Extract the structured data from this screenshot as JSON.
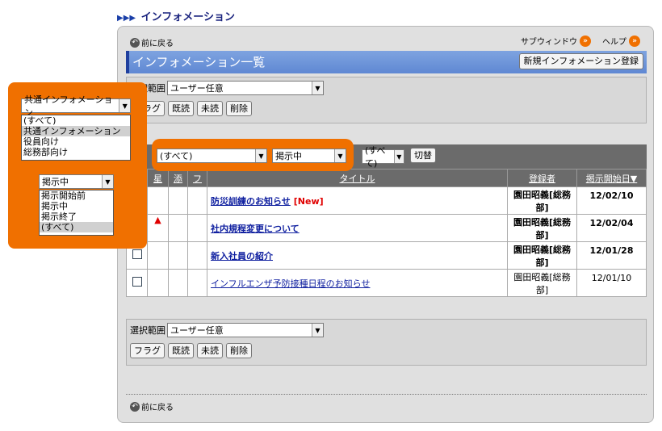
{
  "page_title": "インフォメーション",
  "back_label": "前に戻る",
  "top_links": {
    "subwindow": "サブウィンドウ",
    "help": "ヘルプ"
  },
  "list_title": "インフォメーション一覧",
  "new_button": "新規インフォメーション登録",
  "range_label": "選択範囲",
  "range_value": "ユーザー任意",
  "actions": {
    "flag": "フラグ",
    "read": "既読",
    "unread": "未読",
    "delete": "削除"
  },
  "list_filters": {
    "category_value": "(すべて)",
    "status_value": "掲示中",
    "third_value": "(すべて)",
    "switch_label": "切替",
    "cut_label": "示"
  },
  "columns": {
    "star": "星",
    "attach": "添",
    "flag": "フ",
    "title": "タイトル",
    "registrant": "登録者",
    "start": "掲示開始日▼"
  },
  "rows": [
    {
      "title": "防災訓練のお知らせ",
      "new": "[New]",
      "registrant": "園田昭義[総務部]",
      "date": "12/02/10",
      "bold": true,
      "star": ""
    },
    {
      "title": "社内規程変更について",
      "new": "",
      "registrant": "園田昭義[総務部]",
      "date": "12/02/04",
      "bold": true,
      "star": "▲"
    },
    {
      "title": "新入社員の紹介",
      "new": "",
      "registrant": "園田昭義[総務部]",
      "date": "12/01/28",
      "bold": true,
      "star": ""
    },
    {
      "title": "インフルエンザ予防接種日程のお知らせ",
      "new": "",
      "registrant": "園田昭義[総務部]",
      "date": "12/01/10",
      "bold": false,
      "star": ""
    }
  ],
  "side": {
    "cat_selected": "共通インフォメーション",
    "cat_options": [
      "(すべて)",
      "共通インフォメーション",
      "役員向け",
      "総務部向け"
    ],
    "status_selected": "掲示中",
    "status_options": [
      "掲示開始前",
      "掲示中",
      "掲示終了",
      "(すべて)"
    ],
    "top_cut": "グ"
  },
  "colors": {
    "accent": "#f07000",
    "title_bar": "#5f88d3",
    "link": "#1020a0"
  }
}
